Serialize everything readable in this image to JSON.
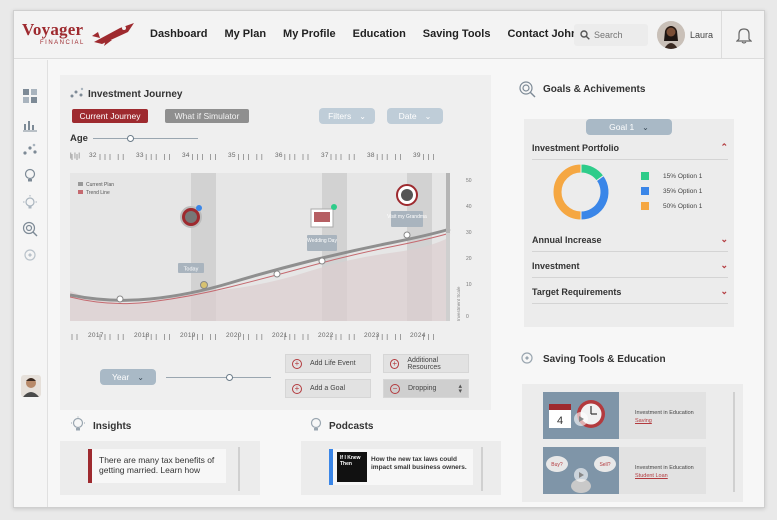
{
  "app": {
    "brand": "Voyager",
    "brand_sub": "FINANCIAL",
    "brand_color": "#9e2a2f"
  },
  "nav": {
    "items": [
      "Dashboard",
      "My Plan",
      "My Profile",
      "Education",
      "Saving Tools",
      "Contact John"
    ]
  },
  "search": {
    "placeholder": "Search"
  },
  "user": {
    "name": "Laura"
  },
  "journey": {
    "title": "Investment Journey",
    "tab_current": "Current Journey",
    "tab_whatif": "What if Simulator",
    "filters_label": "Filters",
    "date_label": "Date",
    "age_label": "Age",
    "age_slider_value": 0.35,
    "age_ticks": [
      "32",
      "33",
      "34",
      "35",
      "36",
      "37",
      "38",
      "39"
    ],
    "year_ticks": [
      "2017",
      "2018",
      "2019",
      "2020",
      "2021",
      "2022",
      "2023",
      "2024"
    ],
    "legend": [
      "Current Plan",
      "Trend Line"
    ],
    "y_axis_label": "Investment Scale",
    "y_ticks": [
      "50",
      "40",
      "30",
      "20",
      "10",
      "0"
    ],
    "events": [
      "Today",
      "Wedding Day",
      "Visit my Grandma"
    ],
    "year_select": "Year",
    "year_slider_value": 0.6,
    "actions": {
      "add_life_event": "Add Life Event",
      "additional_resources": "Additional Resources",
      "add_goal": "Add a Goal",
      "dropping": "Dropping"
    }
  },
  "goals": {
    "title": "Goals & Achivements",
    "goal_select": "Goal 1",
    "portfolio_title": "Investment Portfolio",
    "portfolio": [
      {
        "label": "15% Option 1",
        "value": 15,
        "color": "#2ecc8a"
      },
      {
        "label": "35% Option 1",
        "value": 35,
        "color": "#3a86e8"
      },
      {
        "label": "50% Option 1",
        "value": 50,
        "color": "#f5a742"
      }
    ],
    "rows": [
      "Annual Increase",
      "Investment",
      "Target Requirements"
    ]
  },
  "saving": {
    "title": "Saving Tools & Education",
    "items": [
      {
        "title": "Investment in Education",
        "link": "Saving"
      },
      {
        "title": "Investment in Education",
        "link": "Student Loan"
      }
    ]
  },
  "insights": {
    "title": "Insights",
    "text": "There are many tax benefits of getting married. Learn how"
  },
  "podcasts": {
    "title": "Podcasts",
    "thumb_text": "If I Knew Then",
    "text": "How the new tax laws could impact small business owners."
  }
}
